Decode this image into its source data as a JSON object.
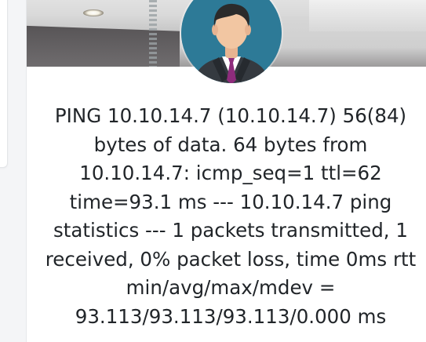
{
  "output": {
    "text": "PING 10.10.14.7 (10.10.14.7) 56(84) bytes of data. 64 bytes from 10.10.14.7: icmp_seq=1 ttl=62 time=93.1 ms --- 10.10.14.7 ping statistics --- 1 packets transmitted, 1 received, 0% packet loss, time 0ms rtt min/avg/max/mdev = 93.113/93.113/93.113/0.000 ms"
  },
  "avatar": {
    "icon": "user-avatar-icon",
    "background_color": "#2d7a97"
  },
  "colors": {
    "text": "#212529",
    "card": "#ffffff",
    "page_bg": "#f4f5f7"
  }
}
